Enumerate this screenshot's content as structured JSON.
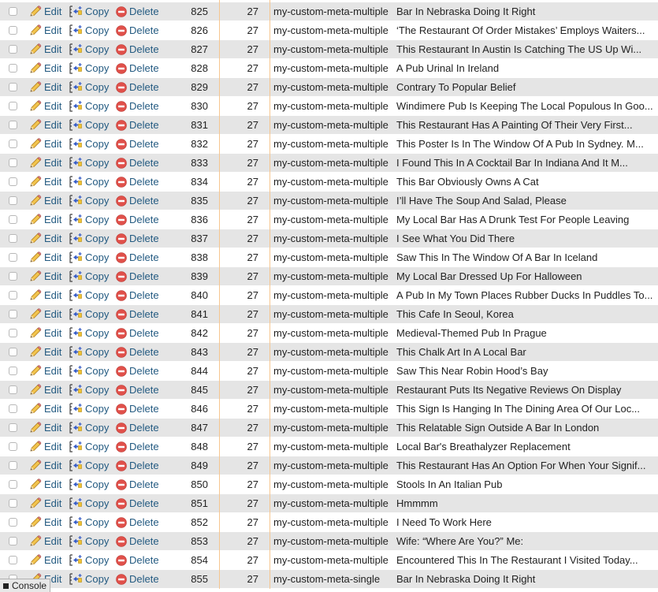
{
  "actions": {
    "edit_label": "Edit",
    "copy_label": "Copy",
    "delete_label": "Delete",
    "edit_icon": "pencil-icon",
    "copy_icon": "copy-row-icon",
    "delete_icon": "delete-circle-icon"
  },
  "colors": {
    "link": "#235a81",
    "row_odd": "#e5e5e5",
    "row_even": "#ffffff",
    "column_marker": "#f6c690",
    "delete_icon": "#e0504a"
  },
  "rows": [
    {
      "meta_id": "825",
      "post_id": "27",
      "meta_key": "my-custom-meta-multiple",
      "meta_value": "Bar In Nebraska Doing It Right"
    },
    {
      "meta_id": "826",
      "post_id": "27",
      "meta_key": "my-custom-meta-multiple",
      "meta_value": "‘The Restaurant Of Order Mistakes’ Employs Waiters..."
    },
    {
      "meta_id": "827",
      "post_id": "27",
      "meta_key": "my-custom-meta-multiple",
      "meta_value": "This Restaurant In Austin Is Catching The US Up Wi..."
    },
    {
      "meta_id": "828",
      "post_id": "27",
      "meta_key": "my-custom-meta-multiple",
      "meta_value": "A Pub Urinal In Ireland"
    },
    {
      "meta_id": "829",
      "post_id": "27",
      "meta_key": "my-custom-meta-multiple",
      "meta_value": "Contrary To Popular Belief"
    },
    {
      "meta_id": "830",
      "post_id": "27",
      "meta_key": "my-custom-meta-multiple",
      "meta_value": "Windimere Pub Is Keeping The Local Populous In Goo..."
    },
    {
      "meta_id": "831",
      "post_id": "27",
      "meta_key": "my-custom-meta-multiple",
      "meta_value": "This Restaurant Has A Painting Of Their Very First..."
    },
    {
      "meta_id": "832",
      "post_id": "27",
      "meta_key": "my-custom-meta-multiple",
      "meta_value": "This Poster Is In The Window Of A Pub In Sydney. M..."
    },
    {
      "meta_id": "833",
      "post_id": "27",
      "meta_key": "my-custom-meta-multiple",
      "meta_value": "I Found This In A Cocktail Bar In Indiana And It M..."
    },
    {
      "meta_id": "834",
      "post_id": "27",
      "meta_key": "my-custom-meta-multiple",
      "meta_value": "This Bar Obviously Owns A Cat"
    },
    {
      "meta_id": "835",
      "post_id": "27",
      "meta_key": "my-custom-meta-multiple",
      "meta_value": "I’ll Have The Soup And Salad, Please"
    },
    {
      "meta_id": "836",
      "post_id": "27",
      "meta_key": "my-custom-meta-multiple",
      "meta_value": "My Local Bar Has A Drunk Test For People Leaving"
    },
    {
      "meta_id": "837",
      "post_id": "27",
      "meta_key": "my-custom-meta-multiple",
      "meta_value": "I See What You Did There"
    },
    {
      "meta_id": "838",
      "post_id": "27",
      "meta_key": "my-custom-meta-multiple",
      "meta_value": "Saw This In The Window Of A Bar In Iceland"
    },
    {
      "meta_id": "839",
      "post_id": "27",
      "meta_key": "my-custom-meta-multiple",
      "meta_value": "My Local Bar Dressed Up For Halloween"
    },
    {
      "meta_id": "840",
      "post_id": "27",
      "meta_key": "my-custom-meta-multiple",
      "meta_value": "A Pub In My Town Places Rubber Ducks In Puddles To..."
    },
    {
      "meta_id": "841",
      "post_id": "27",
      "meta_key": "my-custom-meta-multiple",
      "meta_value": "This Cafe In Seoul, Korea"
    },
    {
      "meta_id": "842",
      "post_id": "27",
      "meta_key": "my-custom-meta-multiple",
      "meta_value": "Medieval-Themed Pub In Prague"
    },
    {
      "meta_id": "843",
      "post_id": "27",
      "meta_key": "my-custom-meta-multiple",
      "meta_value": "This Chalk Art In A Local Bar"
    },
    {
      "meta_id": "844",
      "post_id": "27",
      "meta_key": "my-custom-meta-multiple",
      "meta_value": "Saw This Near Robin Hood’s Bay"
    },
    {
      "meta_id": "845",
      "post_id": "27",
      "meta_key": "my-custom-meta-multiple",
      "meta_value": "Restaurant Puts Its Negative Reviews On Display"
    },
    {
      "meta_id": "846",
      "post_id": "27",
      "meta_key": "my-custom-meta-multiple",
      "meta_value": "This Sign Is Hanging In The Dining Area Of Our Loc..."
    },
    {
      "meta_id": "847",
      "post_id": "27",
      "meta_key": "my-custom-meta-multiple",
      "meta_value": "This Relatable Sign Outside A Bar In London"
    },
    {
      "meta_id": "848",
      "post_id": "27",
      "meta_key": "my-custom-meta-multiple",
      "meta_value": "Local Bar's Breathalyzer Replacement"
    },
    {
      "meta_id": "849",
      "post_id": "27",
      "meta_key": "my-custom-meta-multiple",
      "meta_value": "This Restaurant Has An Option For When Your Signif..."
    },
    {
      "meta_id": "850",
      "post_id": "27",
      "meta_key": "my-custom-meta-multiple",
      "meta_value": "Stools In An Italian Pub"
    },
    {
      "meta_id": "851",
      "post_id": "27",
      "meta_key": "my-custom-meta-multiple",
      "meta_value": "Hmmmm"
    },
    {
      "meta_id": "852",
      "post_id": "27",
      "meta_key": "my-custom-meta-multiple",
      "meta_value": "I Need To Work Here"
    },
    {
      "meta_id": "853",
      "post_id": "27",
      "meta_key": "my-custom-meta-multiple",
      "meta_value": "Wife: “Where Are You?” Me:"
    },
    {
      "meta_id": "854",
      "post_id": "27",
      "meta_key": "my-custom-meta-multiple",
      "meta_value": "Encountered This In The Restaurant I Visited Today..."
    },
    {
      "meta_id": "855",
      "post_id": "27",
      "meta_key": "my-custom-meta-single",
      "meta_value": "Bar In Nebraska Doing It Right"
    }
  ],
  "console": {
    "label": "Console"
  }
}
